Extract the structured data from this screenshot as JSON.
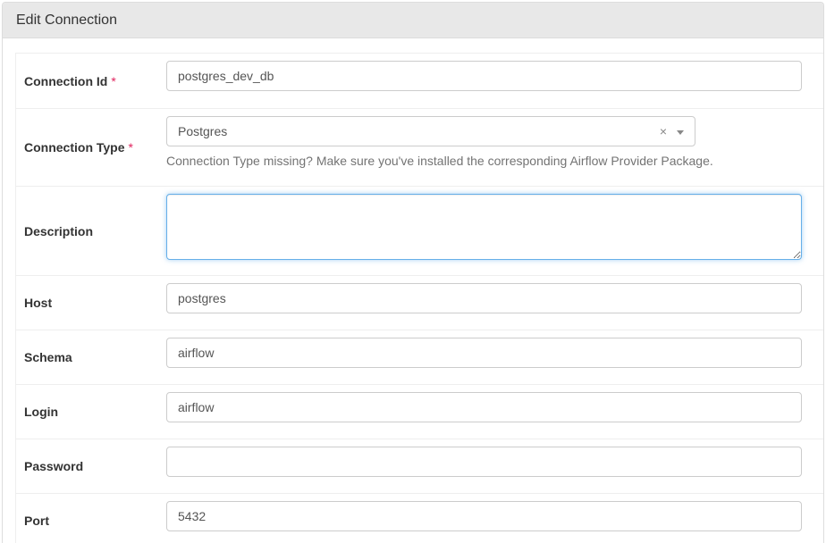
{
  "panel": {
    "title": "Edit Connection"
  },
  "fields": {
    "conn_id": {
      "label": "Connection Id",
      "required": "*",
      "value": "postgres_dev_db"
    },
    "conn_type": {
      "label": "Connection Type",
      "required": "*",
      "value": "Postgres",
      "clear_glyph": "×",
      "help": "Connection Type missing? Make sure you've installed the corresponding Airflow Provider Package."
    },
    "description": {
      "label": "Description",
      "value": ""
    },
    "host": {
      "label": "Host",
      "value": "postgres"
    },
    "schema": {
      "label": "Schema",
      "value": "airflow"
    },
    "login": {
      "label": "Login",
      "value": "airflow"
    },
    "password": {
      "label": "Password",
      "value": ""
    },
    "port": {
      "label": "Port",
      "value": "5432"
    }
  },
  "colors": {
    "required_marker": "#e0245e",
    "focus_border": "#66afe9",
    "heading_bg": "#e8e8e8"
  }
}
